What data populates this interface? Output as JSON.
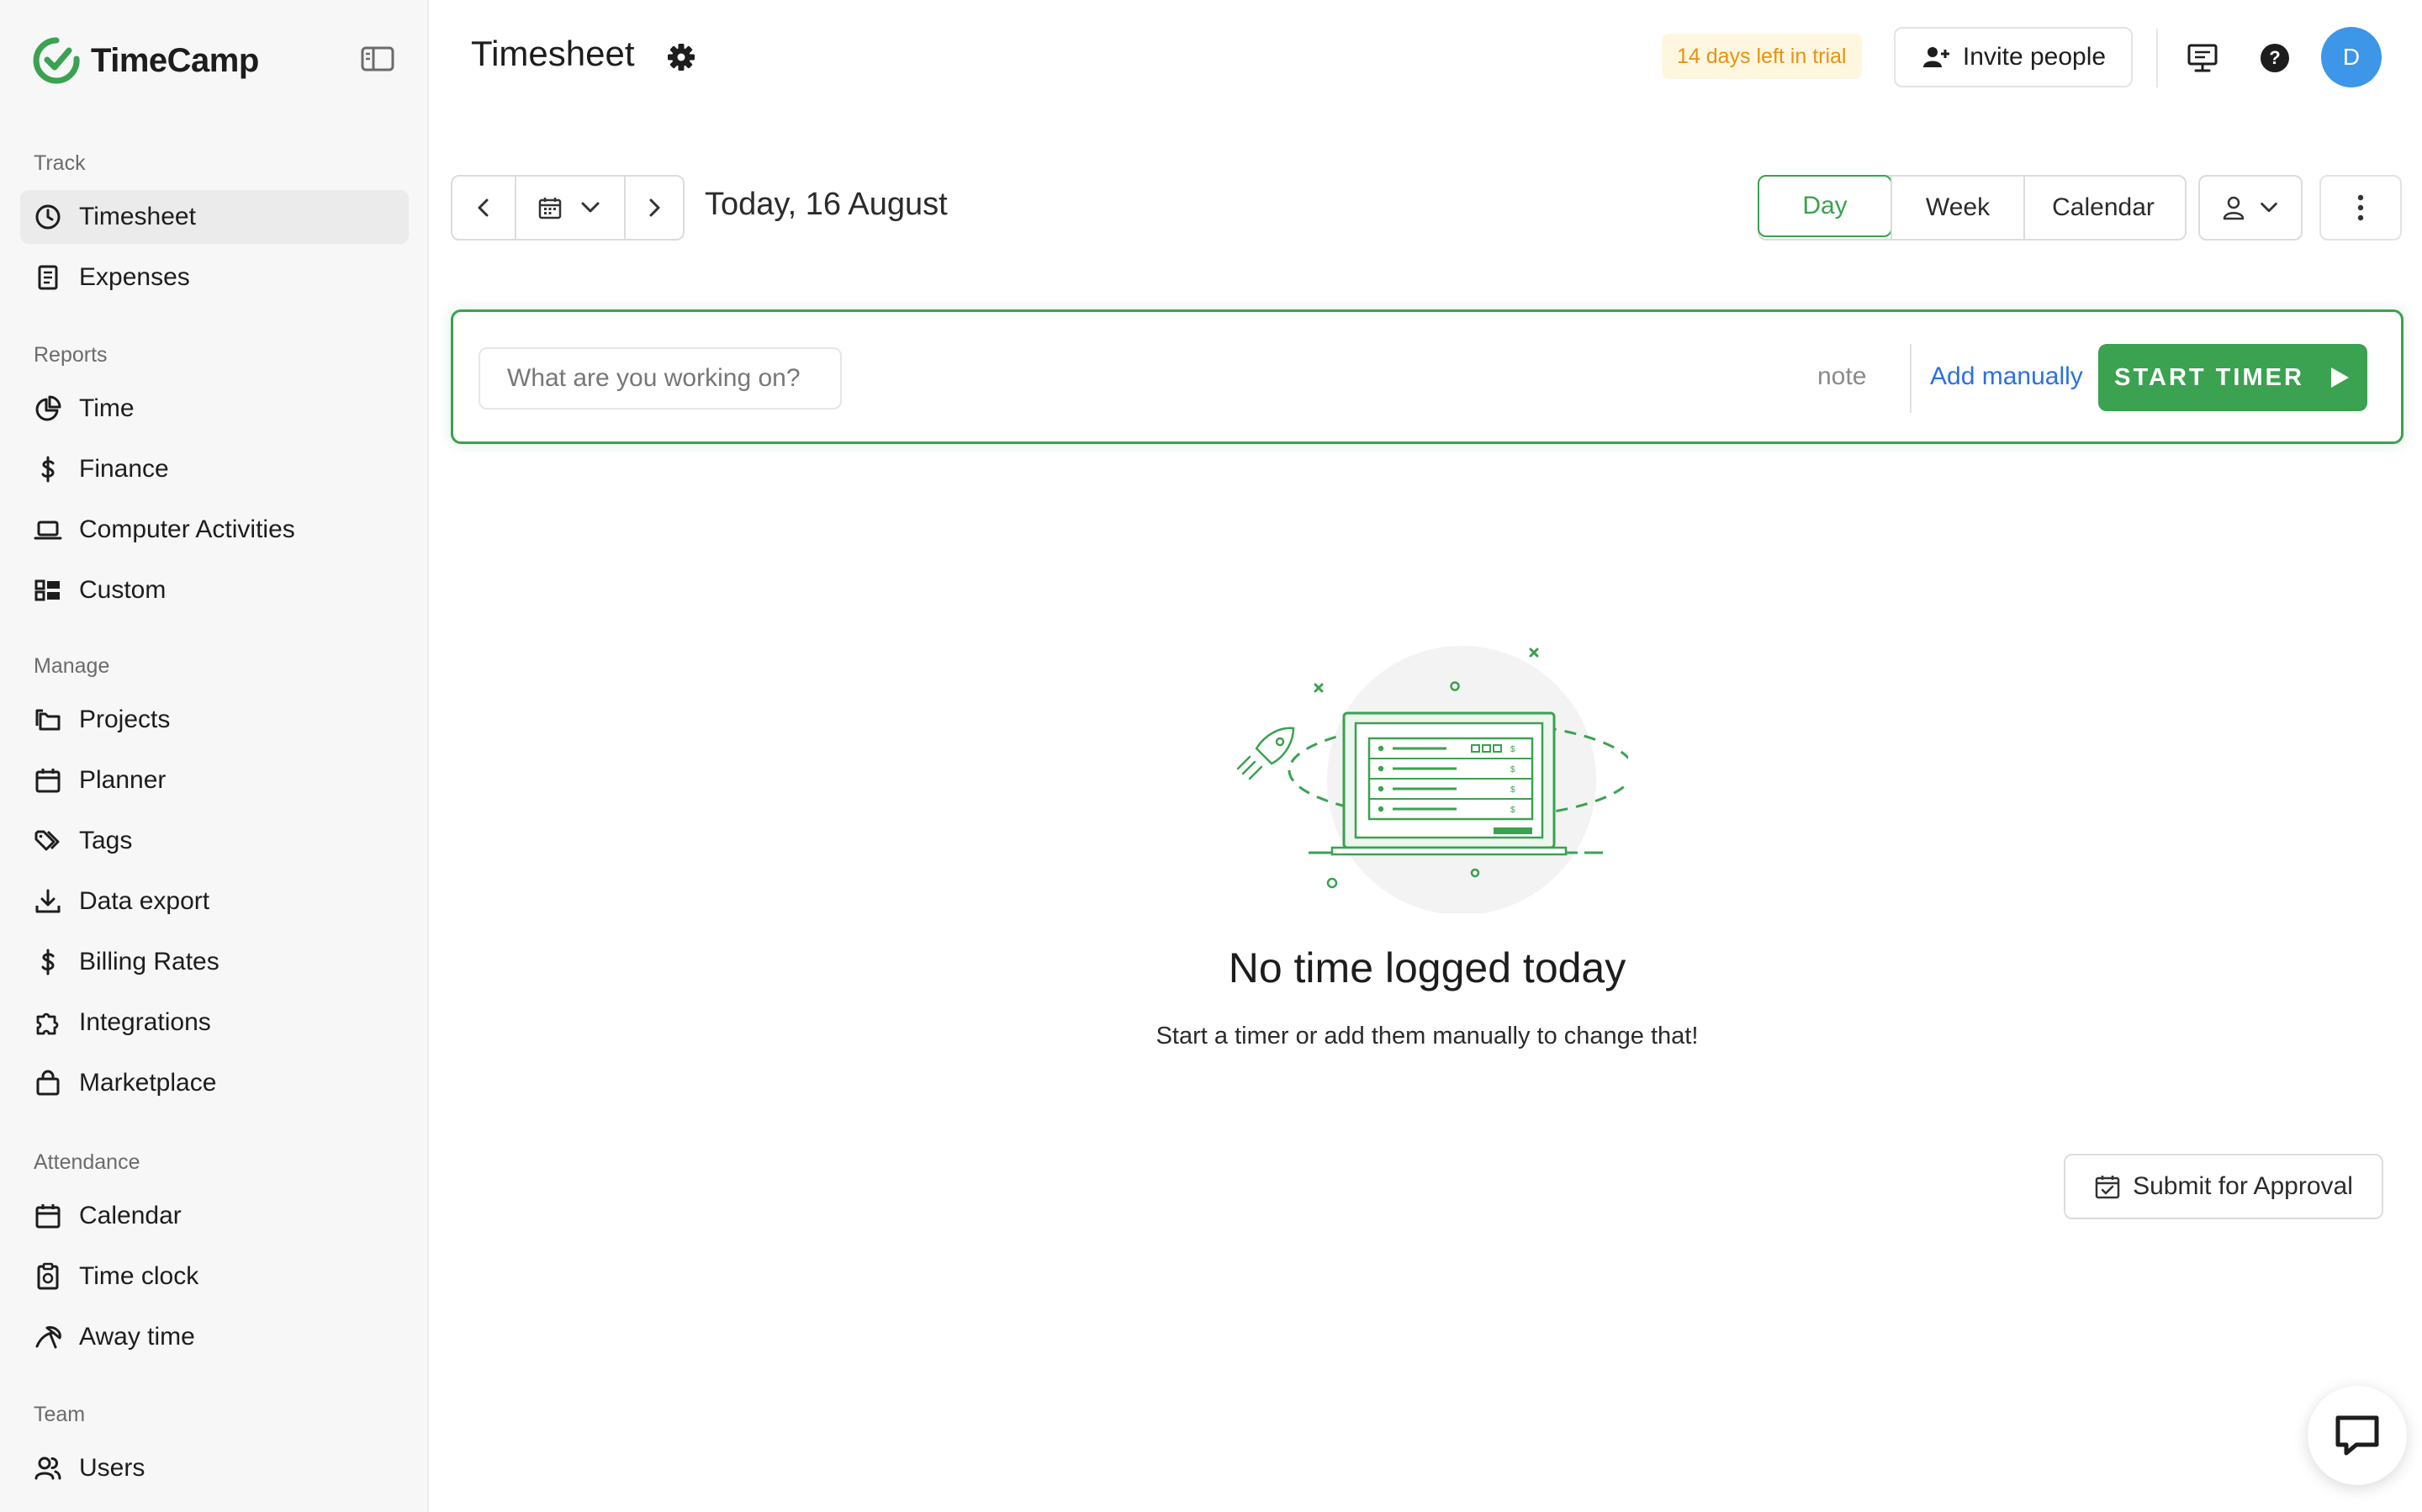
{
  "app": {
    "name": "TimeCamp",
    "brand_color": "#3aa250",
    "link_color": "#2c70e0"
  },
  "sidebar": {
    "sections": [
      {
        "title": "Track",
        "items": [
          {
            "label": "Timesheet",
            "icon": "clock-icon",
            "active": true
          },
          {
            "label": "Expenses",
            "icon": "receipt-icon"
          }
        ]
      },
      {
        "title": "Reports",
        "items": [
          {
            "label": "Time",
            "icon": "pie-chart-icon"
          },
          {
            "label": "Finance",
            "icon": "dollar-icon"
          },
          {
            "label": "Computer Activities",
            "icon": "laptop-icon"
          },
          {
            "label": "Custom",
            "icon": "custom-report-icon"
          }
        ]
      },
      {
        "title": "Manage",
        "items": [
          {
            "label": "Projects",
            "icon": "folders-icon"
          },
          {
            "label": "Planner",
            "icon": "calendar-icon"
          },
          {
            "label": "Tags",
            "icon": "tags-icon"
          },
          {
            "label": "Data export",
            "icon": "download-icon"
          },
          {
            "label": "Billing Rates",
            "icon": "dollar-icon"
          },
          {
            "label": "Integrations",
            "icon": "puzzle-icon"
          },
          {
            "label": "Marketplace",
            "icon": "shopping-bag-icon"
          }
        ]
      },
      {
        "title": "Attendance",
        "items": [
          {
            "label": "Calendar",
            "icon": "calendar-icon"
          },
          {
            "label": "Time clock",
            "icon": "clipboard-icon"
          },
          {
            "label": "Away time",
            "icon": "away-icon"
          }
        ]
      },
      {
        "title": "Team",
        "items": [
          {
            "label": "Users",
            "icon": "users-icon"
          }
        ]
      }
    ]
  },
  "header": {
    "title": "Timesheet",
    "trial_badge": "14 days left in trial",
    "invite_label": "Invite people",
    "avatar_initial": "D"
  },
  "toolbar": {
    "date_label": "Today, 16 August",
    "views": [
      {
        "label": "Day",
        "active": true
      },
      {
        "label": "Week"
      },
      {
        "label": "Calendar"
      }
    ]
  },
  "timer": {
    "placeholder": "What are you working on?",
    "note_label": "note",
    "add_manually_label": "Add manually",
    "start_label": "START TIMER"
  },
  "empty_state": {
    "title": "No time logged today",
    "subtitle": "Start a timer or add them manually to change that!"
  },
  "footer": {
    "submit_label": "Submit for Approval"
  }
}
